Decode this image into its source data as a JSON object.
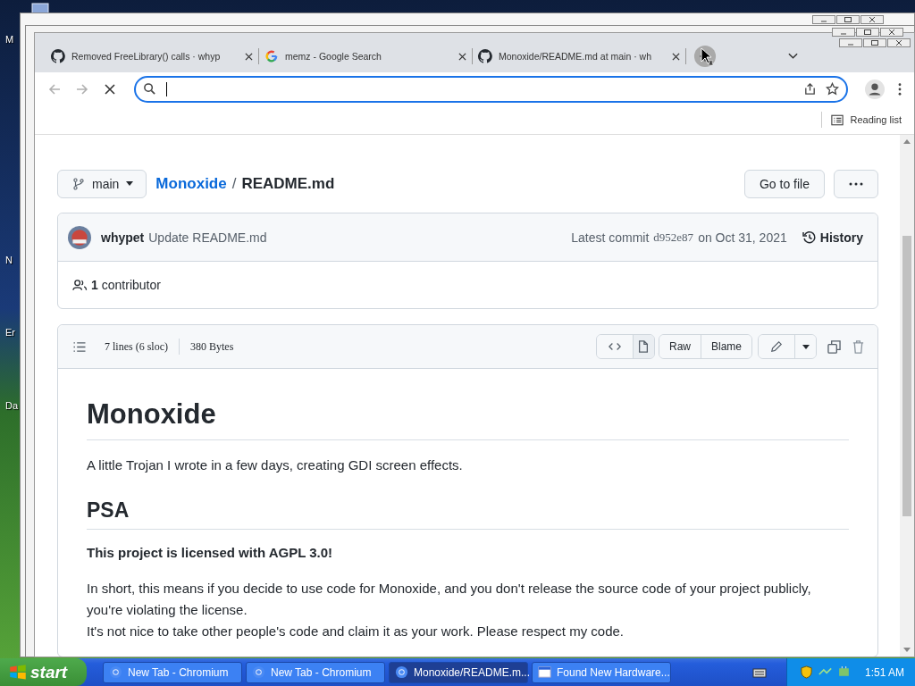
{
  "desktop": {
    "labels": [
      "M",
      "N",
      "Er",
      "Da"
    ]
  },
  "browser": {
    "tabs": [
      {
        "title": "Removed FreeLibrary() calls · whyp",
        "kind": "github",
        "selected": false
      },
      {
        "title": "memz - Google Search",
        "kind": "google",
        "selected": false
      },
      {
        "title": "Monoxide/README.md at main · wh",
        "kind": "github",
        "selected": false
      }
    ],
    "omnibox": {
      "loading": true
    },
    "reading_list": "Reading list"
  },
  "page": {
    "branch": "main",
    "repo": "Monoxide",
    "separator": "/",
    "file": "README.md",
    "go_to_file": "Go to file",
    "commit": {
      "author": "whypet",
      "message": "Update README.md",
      "latest_label": "Latest commit",
      "hash": "d952e87",
      "date": "on Oct 31, 2021",
      "history": "History"
    },
    "contributors": {
      "count": "1",
      "label": "contributor"
    },
    "file_info": {
      "lines": "7 lines (6 sloc)",
      "size": "380 Bytes",
      "view_buttons": [
        {
          "kind": "code",
          "selected": false
        },
        {
          "kind": "preview",
          "selected": true
        }
      ],
      "raw": "Raw",
      "blame": "Blame"
    },
    "readme": [
      {
        "kind": "h1",
        "text": "Monoxide"
      },
      {
        "kind": "p",
        "lines": [
          "A little Trojan I wrote in a few days, creating GDI screen effects."
        ]
      },
      {
        "kind": "h2",
        "text": "PSA"
      },
      {
        "kind": "strong",
        "text": "This project is licensed with AGPL 3.0!"
      },
      {
        "kind": "p",
        "lines": [
          "In short, this means if you decide to use code for Monoxide, and you don't release the source code of your project publicly, you're violating the license.",
          "It's not nice to take other people's code and claim it as your work. Please respect my code."
        ]
      }
    ]
  },
  "taskbar": {
    "start": "start",
    "items": [
      {
        "label": "New Tab - Chromium",
        "kind": "chromium",
        "selected": false
      },
      {
        "label": "New Tab - Chromium",
        "kind": "chromium",
        "selected": false
      },
      {
        "label": "Monoxide/README.m...",
        "kind": "chromium",
        "selected": true
      },
      {
        "label": "Found New Hardware...",
        "kind": "window",
        "selected": false
      }
    ],
    "clock": "1:51 AM"
  }
}
